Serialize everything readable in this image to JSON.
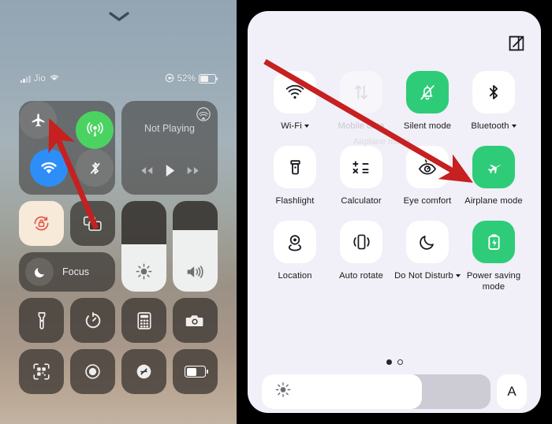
{
  "ios": {
    "status": {
      "carrier": "Jio",
      "battery_percent": "52%",
      "battery_level": 52
    },
    "connectivity": {
      "airplane": {
        "name": "airplane-mode",
        "state": "off"
      },
      "cellular": {
        "name": "cellular-data",
        "state": "on"
      },
      "wifi": {
        "name": "wifi",
        "state": "on"
      },
      "bluetooth": {
        "name": "bluetooth",
        "state": "off"
      }
    },
    "media": {
      "title": "Not Playing",
      "airplay": "airplay-icon",
      "prev": "rewind-button",
      "play": "play-button",
      "next": "fast-forward-button"
    },
    "rotation_lock": {
      "label": "rotation-lock",
      "state": "on"
    },
    "screen_mirror": {
      "label": "screen-mirroring",
      "state": "off"
    },
    "focus": {
      "label": "Focus"
    },
    "brightness": {
      "value": 52
    },
    "volume": {
      "value": 68
    },
    "tiles": [
      {
        "name": "flashlight"
      },
      {
        "name": "timer"
      },
      {
        "name": "calculator"
      },
      {
        "name": "camera"
      },
      {
        "name": "qr-scanner"
      },
      {
        "name": "screen-record"
      },
      {
        "name": "shazam"
      },
      {
        "name": "low-power-mode"
      }
    ]
  },
  "android": {
    "edit_icon": "edit-icon",
    "rows": [
      [
        {
          "label": "Wi-Fi",
          "caret": true,
          "state": "off",
          "icon": "wifi-icon"
        },
        {
          "label": "Mobile data",
          "caret": false,
          "state": "dim",
          "icon": "mobile-data-icon"
        },
        {
          "label": "Silent mode",
          "caret": false,
          "state": "on",
          "icon": "bell-off-icon"
        },
        {
          "label": "Bluetooth",
          "caret": true,
          "state": "off",
          "icon": "bluetooth-icon"
        }
      ],
      [
        {
          "label": "Flashlight",
          "caret": false,
          "state": "off",
          "icon": "flashlight-icon"
        },
        {
          "label": "Calculator",
          "caret": false,
          "state": "off",
          "icon": "calculator-icon"
        },
        {
          "label": "Eye comfort",
          "caret": false,
          "state": "off",
          "icon": "eye-comfort-icon"
        },
        {
          "label": "Airplane mode",
          "caret": false,
          "state": "on",
          "icon": "airplane-icon"
        }
      ],
      [
        {
          "label": "Location",
          "caret": false,
          "state": "off",
          "icon": "location-icon"
        },
        {
          "label": "Auto rotate",
          "caret": false,
          "state": "off",
          "icon": "auto-rotate-icon"
        },
        {
          "label": "Do Not Disturb",
          "caret": true,
          "state": "off",
          "icon": "moon-icon"
        },
        {
          "label": "Power saving mode",
          "caret": false,
          "state": "on",
          "icon": "battery-saver-icon"
        }
      ]
    ],
    "ghost_label": "Airplane mode",
    "pages": {
      "count": 2,
      "active": 0
    },
    "brightness": {
      "value": 70,
      "icon": "brightness-icon"
    },
    "auto_brightness": {
      "label": "A"
    }
  },
  "annotations": {
    "accent_color": "#c62020",
    "arrows": [
      {
        "name": "arrow-to-ios-airplane",
        "points_to": "airplane-mode"
      },
      {
        "name": "arrow-to-android-airplane",
        "points_to": "Airplane mode"
      }
    ]
  }
}
